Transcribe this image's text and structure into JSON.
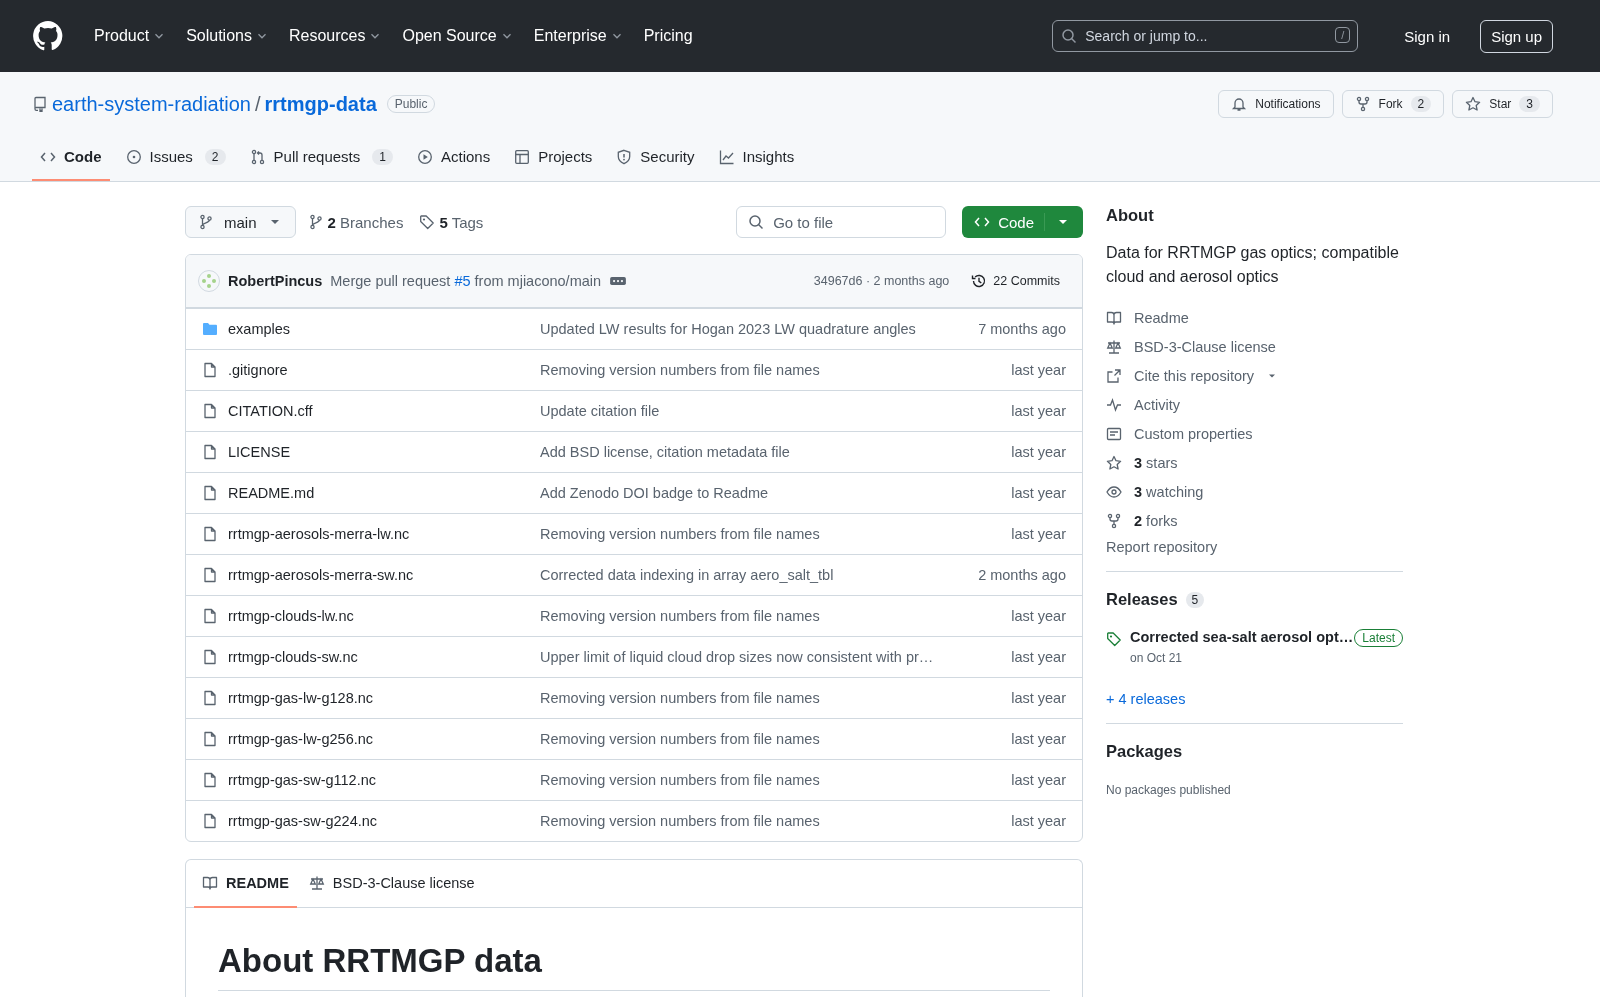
{
  "header": {
    "nav": [
      {
        "label": "Product",
        "dropdown": true
      },
      {
        "label": "Solutions",
        "dropdown": true
      },
      {
        "label": "Resources",
        "dropdown": true
      },
      {
        "label": "Open Source",
        "dropdown": true
      },
      {
        "label": "Enterprise",
        "dropdown": true
      },
      {
        "label": "Pricing",
        "dropdown": false
      }
    ],
    "search": {
      "placeholder": "Search or jump to...",
      "shortcut": "/"
    },
    "sign_in": "Sign in",
    "sign_up": "Sign up"
  },
  "repo": {
    "owner": "earth-system-radiation",
    "separator": "/",
    "name": "rrtmgp-data",
    "visibility": "Public",
    "actions": [
      {
        "kind": "notifications",
        "label": "Notifications"
      },
      {
        "kind": "fork",
        "label": "Fork",
        "count": "2"
      },
      {
        "kind": "star",
        "label": "Star",
        "count": "3"
      }
    ]
  },
  "tabs": [
    {
      "kind": "code",
      "label": "Code",
      "selected": true
    },
    {
      "kind": "issues",
      "label": "Issues",
      "count": "2",
      "selected": false
    },
    {
      "kind": "pulls",
      "label": "Pull requests",
      "count": "1",
      "selected": false
    },
    {
      "kind": "actions",
      "label": "Actions",
      "selected": false
    },
    {
      "kind": "projects",
      "label": "Projects",
      "selected": false
    },
    {
      "kind": "security",
      "label": "Security",
      "selected": false
    },
    {
      "kind": "insights",
      "label": "Insights",
      "selected": false
    }
  ],
  "toolbar": {
    "branch": "main",
    "branches": "**2** Branches",
    "tags": "**5** Tags",
    "go_to_file": {
      "placeholder": "Go to file"
    },
    "code_button": "Code"
  },
  "commit": {
    "author": "RobertPincus",
    "message_before": "Merge pull request ",
    "link": "#5",
    "message_after": " from mjiacono/main",
    "hash_time": "34967d6 · 2 months ago",
    "commits": "22 Commits"
  },
  "files": [
    {
      "kind": "folder",
      "name": "examples",
      "message": "Updated LW results for Hogan 2023 LW quadrature angles",
      "time": "7 months ago"
    },
    {
      "kind": "file",
      "name": ".gitignore",
      "message": "Removing version numbers from file names",
      "time": "last year"
    },
    {
      "kind": "file",
      "name": "CITATION.cff",
      "message": "Update citation file",
      "time": "last year"
    },
    {
      "kind": "file",
      "name": "LICENSE",
      "message": "Add BSD license, citation metadata file",
      "time": "last year"
    },
    {
      "kind": "file",
      "name": "README.md",
      "message": "Add Zenodo DOI badge to Readme",
      "time": "last year"
    },
    {
      "kind": "file",
      "name": "rrtmgp-aerosols-merra-lw.nc",
      "message": "Removing version numbers from file names",
      "time": "last year"
    },
    {
      "kind": "file",
      "name": "rrtmgp-aerosols-merra-sw.nc",
      "message": "Corrected data indexing in array aero_salt_tbl",
      "time": "2 months ago"
    },
    {
      "kind": "file",
      "name": "rrtmgp-clouds-lw.nc",
      "message": "Removing version numbers from file names",
      "time": "last year"
    },
    {
      "kind": "file",
      "name": "rrtmgp-clouds-sw.nc",
      "message": "Upper limit of liquid cloud drop sizes now consistent with pr…",
      "time": "last year"
    },
    {
      "kind": "file",
      "name": "rrtmgp-gas-lw-g128.nc",
      "message": "Removing version numbers from file names",
      "time": "last year"
    },
    {
      "kind": "file",
      "name": "rrtmgp-gas-lw-g256.nc",
      "message": "Removing version numbers from file names",
      "time": "last year"
    },
    {
      "kind": "file",
      "name": "rrtmgp-gas-sw-g112.nc",
      "message": "Removing version numbers from file names",
      "time": "last year"
    },
    {
      "kind": "file",
      "name": "rrtmgp-gas-sw-g224.nc",
      "message": "Removing version numbers from file names",
      "time": "last year"
    }
  ],
  "readme": {
    "tabs": [
      {
        "kind": "readme",
        "label": "README",
        "selected": true
      },
      {
        "kind": "license",
        "label": "BSD-3-Clause license",
        "selected": false
      }
    ],
    "heading": "About RRTMGP data"
  },
  "about": {
    "title": "About",
    "description": "Data for RRTMGP gas optics; compatible cloud and aerosol optics",
    "links": [
      {
        "kind": "readme",
        "text": "Readme",
        "dropdown": false
      },
      {
        "kind": "license",
        "text": "BSD-3-Clause license",
        "dropdown": false
      },
      {
        "kind": "cite",
        "text": "Cite this repository",
        "dropdown": true
      },
      {
        "kind": "activity",
        "text": "Activity",
        "dropdown": false
      },
      {
        "kind": "properties",
        "text": "Custom properties",
        "dropdown": false
      },
      {
        "kind": "stars",
        "text": "**3** stars",
        "dropdown": false
      },
      {
        "kind": "watching",
        "text": "**3** watching",
        "dropdown": false
      },
      {
        "kind": "forks",
        "text": "**2** forks",
        "dropdown": false
      }
    ],
    "report": "Report repository"
  },
  "releases": {
    "title": "Releases",
    "count": "5",
    "latest": {
      "name": "Corrected sea-salt aerosol opt…",
      "badge": "Latest",
      "date": "on Oct 21"
    },
    "more": "+ 4 releases"
  },
  "packages": {
    "title": "Packages",
    "empty": "No packages published"
  }
}
